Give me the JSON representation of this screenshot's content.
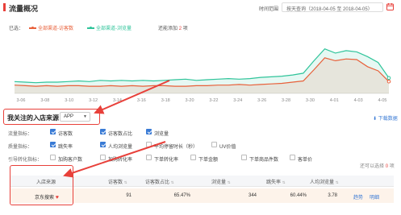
{
  "header": {
    "title": "流量概况",
    "time_label": "时间范围",
    "date_range": "按天查询（2018-04-05 至 2018-04-05）"
  },
  "legend_bar": {
    "selected_label": "已选：",
    "items": [
      {
        "label": "全部渠道-访客数",
        "color": "#e8603a"
      },
      {
        "label": "全部渠道-浏览量",
        "color": "#2fc49a"
      }
    ],
    "hint_prefix": "还能添加",
    "hint_count": "2",
    "hint_suffix": "项"
  },
  "chart_data": {
    "type": "line",
    "x": [
      "3-06",
      "3-08",
      "3-10",
      "3-12",
      "3-14",
      "3-16",
      "3-18",
      "3-20",
      "3-22",
      "3-24",
      "3-26",
      "3-28",
      "3-30",
      "4-01",
      "4-03",
      "4-05"
    ],
    "series": [
      {
        "name": "全部渠道-访客数",
        "color": "#e8603a",
        "values": [
          14,
          13,
          12,
          13,
          12,
          13,
          13,
          12,
          12,
          13,
          12,
          13,
          12,
          13,
          13,
          12,
          12,
          13,
          13,
          14,
          14,
          15,
          14,
          15,
          16,
          17,
          19,
          21,
          40,
          60,
          55,
          58,
          57,
          45,
          38,
          20
        ]
      },
      {
        "name": "全部渠道-浏览量",
        "color": "#2fc49a",
        "values": [
          20,
          19,
          18,
          19,
          19,
          20,
          21,
          20,
          22,
          21,
          22,
          21,
          22,
          21,
          22,
          23,
          24,
          22,
          23,
          24,
          25,
          24,
          25,
          27,
          28,
          29,
          31,
          34,
          55,
          75,
          68,
          72,
          70,
          62,
          52,
          26
        ]
      }
    ],
    "ylim": [
      0,
      80
    ],
    "grid": false,
    "area_fill": true
  },
  "source": {
    "title": "我关注的入店来源",
    "select_value": "APP",
    "download_label": "下载数据"
  },
  "filters": [
    {
      "label": "流量指标：",
      "items": [
        {
          "text": "访客数",
          "checked": true
        },
        {
          "text": "访客数占比",
          "checked": true
        },
        {
          "text": "浏览量",
          "checked": true
        }
      ]
    },
    {
      "label": "质量指标：",
      "items": [
        {
          "text": "跳失率",
          "checked": true
        },
        {
          "text": "人均浏览量",
          "checked": true
        },
        {
          "text": "平均停留时长（秒）",
          "checked": false
        },
        {
          "text": "UV价值",
          "checked": false
        }
      ]
    },
    {
      "label": "引导转化指标：",
      "items": [
        {
          "text": "加购客户数",
          "checked": false
        },
        {
          "text": "加购转化率",
          "checked": false
        },
        {
          "text": "下单转化率",
          "checked": false
        },
        {
          "text": "下单金额",
          "checked": false
        },
        {
          "text": "下单商品件数",
          "checked": false
        },
        {
          "text": "客单价",
          "checked": false
        }
      ]
    }
  ],
  "chosen_hint": {
    "prefix": "还可以选择",
    "count": "0",
    "suffix": "项"
  },
  "table": {
    "columns": [
      "入店来源",
      "访客数",
      "访客数占比",
      "浏览量",
      "跳失率",
      "人均浏览量"
    ],
    "rows": [
      {
        "source": "京东搜索",
        "visitors": "91",
        "visitor_share": "65.47%",
        "pageviews": "344",
        "bounce": "60.44%",
        "avg_views": "3.78"
      }
    ],
    "action_trend": "趋势",
    "action_detail": "明细"
  }
}
